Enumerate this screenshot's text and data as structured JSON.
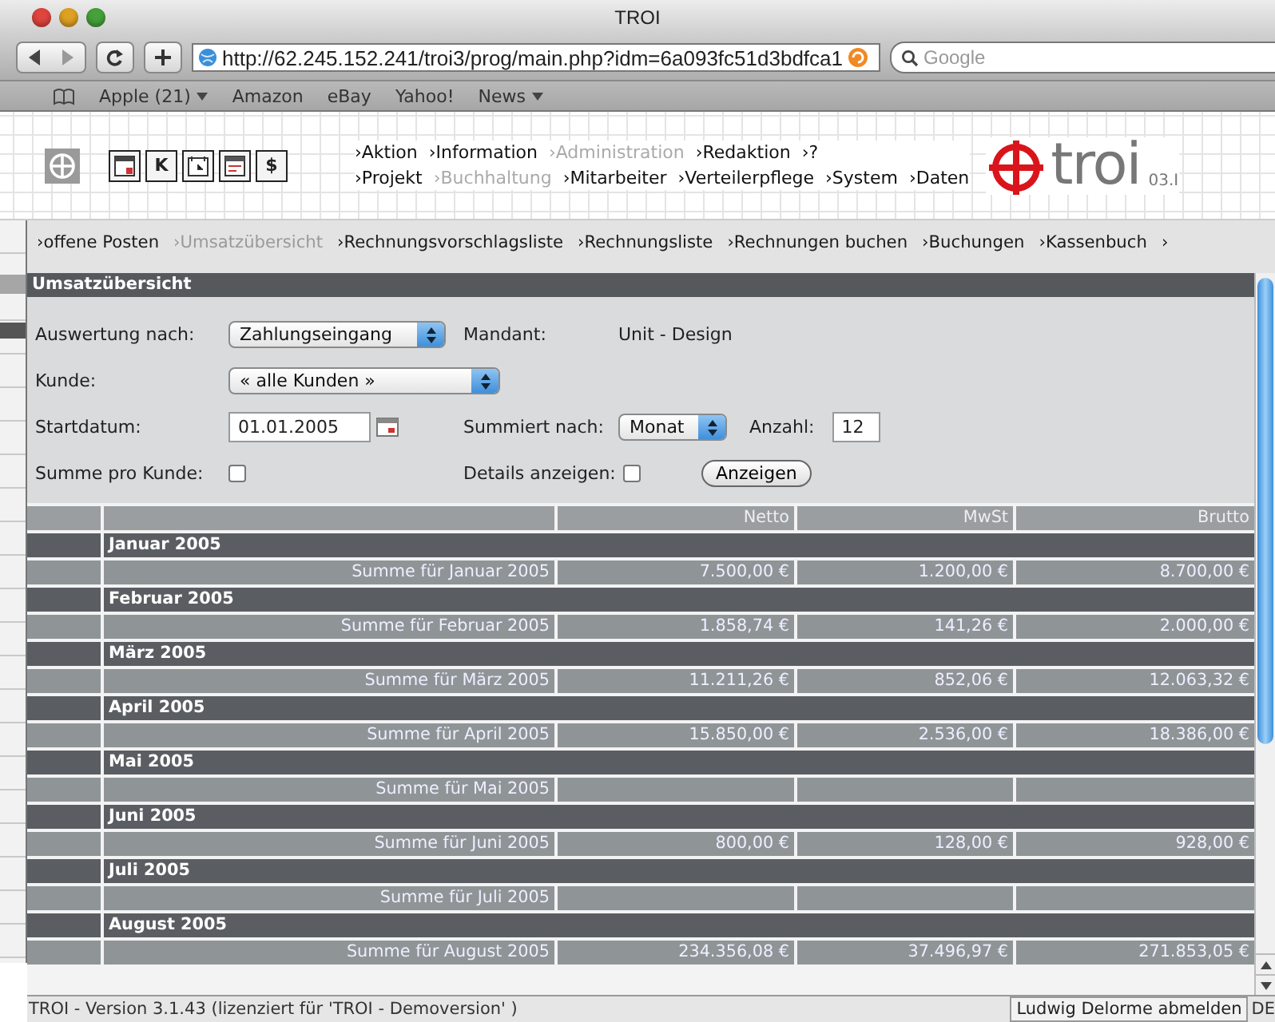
{
  "window": {
    "title": "TROI"
  },
  "toolbar": {
    "url": "http://62.245.152.241/troi3/prog/main.php?idm=6a093fc51d3bdfca1",
    "search": {
      "placeholder": "Google"
    }
  },
  "bookmarks": [
    {
      "label": "Apple (21)",
      "menu": true
    },
    {
      "label": "Amazon",
      "menu": false
    },
    {
      "label": "eBay",
      "menu": false
    },
    {
      "label": "Yahoo!",
      "menu": false
    },
    {
      "label": "News",
      "menu": true
    }
  ],
  "header": {
    "tools": [
      {
        "kind": "calendar"
      },
      {
        "kind": "letter",
        "label": "K"
      },
      {
        "kind": "clock"
      },
      {
        "kind": "window"
      },
      {
        "kind": "money",
        "label": "$"
      }
    ],
    "menu_rows": [
      [
        {
          "label": "›Aktion",
          "disabled": false
        },
        {
          "label": "›Information",
          "disabled": false
        },
        {
          "label": "›Administration",
          "disabled": true
        },
        {
          "label": "›Redaktion",
          "disabled": false
        },
        {
          "label": "›?",
          "disabled": false
        }
      ],
      [
        {
          "label": "›Projekt",
          "disabled": false
        },
        {
          "label": "›Buchhaltung",
          "disabled": true
        },
        {
          "label": "›Mitarbeiter",
          "disabled": false
        },
        {
          "label": "›Verteilerpflege",
          "disabled": false
        },
        {
          "label": "›System",
          "disabled": false
        },
        {
          "label": "›Daten",
          "disabled": false
        }
      ]
    ],
    "logo": {
      "name": "troi",
      "version": "03.I"
    }
  },
  "subnav": [
    {
      "label": "›offene Posten",
      "selected": false
    },
    {
      "label": "›Umsatzübersicht",
      "selected": true
    },
    {
      "label": "›Rechnungsvorschlagsliste",
      "selected": false
    },
    {
      "label": "›Rechnungsliste",
      "selected": false
    },
    {
      "label": "›Rechnungen buchen",
      "selected": false
    },
    {
      "label": "›Buchungen",
      "selected": false
    },
    {
      "label": "›Kassenbuch",
      "selected": false
    },
    {
      "label": "›",
      "selected": false
    }
  ],
  "panel": {
    "title": "Umsatzübersicht",
    "auswertung": {
      "label": "Auswertung nach:",
      "value": "Zahlungseingang"
    },
    "mandant": {
      "label": "Mandant:",
      "value": "Unit - Design"
    },
    "kunde": {
      "label": "Kunde:",
      "value": "« alle Kunden »"
    },
    "startdatum": {
      "label": "Startdatum:",
      "value": "01.01.2005"
    },
    "summiert": {
      "label": "Summiert nach:",
      "value": "Monat"
    },
    "anzahl": {
      "label": "Anzahl:",
      "value": "12"
    },
    "summe_pro_kunde": {
      "label": "Summe pro Kunde:",
      "checked": false
    },
    "details": {
      "label": "Details anzeigen:",
      "checked": false
    },
    "button": "Anzeigen"
  },
  "table": {
    "columns": [
      {
        "label": "Netto"
      },
      {
        "label": "MwSt"
      },
      {
        "label": "Brutto"
      }
    ],
    "rows": [
      {
        "kind": "month",
        "label": "Januar 2005"
      },
      {
        "kind": "sum",
        "label": "Summe für Januar 2005",
        "values": [
          "7.500,00 €",
          "1.200,00 €",
          "8.700,00 €"
        ]
      },
      {
        "kind": "month",
        "label": "Februar 2005"
      },
      {
        "kind": "sum",
        "label": "Summe für Februar 2005",
        "values": [
          "1.858,74 €",
          "141,26 €",
          "2.000,00 €"
        ]
      },
      {
        "kind": "month",
        "label": "März 2005"
      },
      {
        "kind": "sum",
        "label": "Summe für März 2005",
        "values": [
          "11.211,26 €",
          "852,06 €",
          "12.063,32 €"
        ]
      },
      {
        "kind": "month",
        "label": "April 2005"
      },
      {
        "kind": "sum",
        "label": "Summe für April 2005",
        "values": [
          "15.850,00 €",
          "2.536,00 €",
          "18.386,00 €"
        ]
      },
      {
        "kind": "month",
        "label": "Mai 2005"
      },
      {
        "kind": "sum",
        "label": "Summe für Mai 2005"
      },
      {
        "kind": "month",
        "label": "Juni 2005"
      },
      {
        "kind": "sum",
        "label": "Summe für Juni 2005",
        "values": [
          "800,00 €",
          "128,00 €",
          "928,00 €"
        ]
      },
      {
        "kind": "month",
        "label": "Juli 2005"
      },
      {
        "kind": "sum",
        "label": "Summe für Juli 2005"
      },
      {
        "kind": "month",
        "label": "August 2005"
      },
      {
        "kind": "sum",
        "label": "Summe für August 2005",
        "values": [
          "234.356,08 €",
          "37.496,97 €",
          "271.853,05 €"
        ]
      }
    ]
  },
  "status_bar": {
    "text": "TROI - Version 3.1.43 (lizenziert für 'TROI - Demoversion' )",
    "logout": "Ludwig Delorme abmelden",
    "language": "DE"
  }
}
